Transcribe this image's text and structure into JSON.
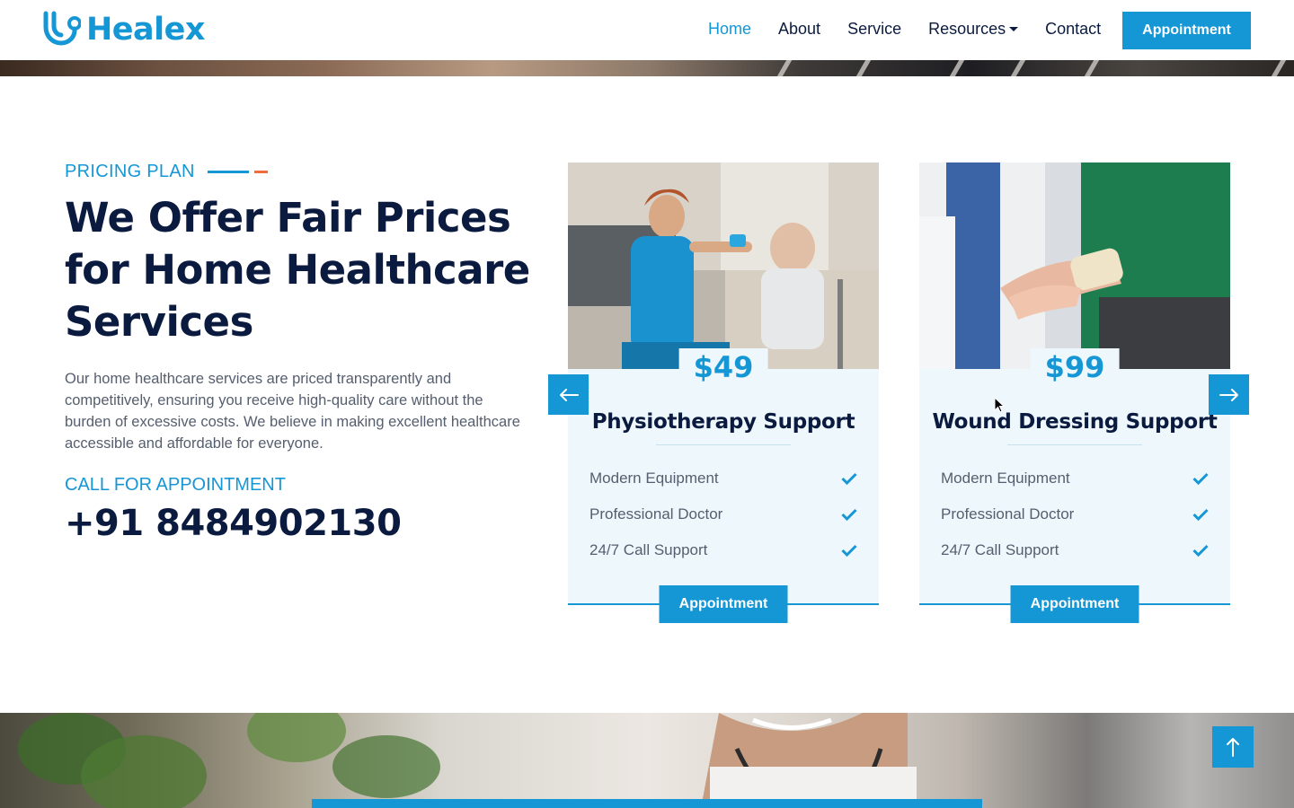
{
  "brand": {
    "name": "Healex",
    "accent": "#1596d5",
    "secondary_accent": "#f26b3a",
    "dark": "#0b1b3f"
  },
  "nav": {
    "items": [
      {
        "label": "Home",
        "active": true
      },
      {
        "label": "About",
        "active": false
      },
      {
        "label": "Service",
        "active": false
      },
      {
        "label": "Resources",
        "active": false,
        "has_dropdown": true
      },
      {
        "label": "Contact",
        "active": false
      }
    ],
    "cta_label": "Appointment"
  },
  "pricing": {
    "eyebrow": "PRICING PLAN",
    "heading": "We Offer Fair Prices for Home Healthcare Services",
    "description": "Our home healthcare services are priced transparently and competitively, ensuring you receive high-quality care without the burden of excessive costs. We believe in making excellent healthcare accessible and affordable for everyone.",
    "call_label": "CALL FOR APPOINTMENT",
    "phone": "+91 8484902130",
    "cards": [
      {
        "price": "$49",
        "title": "Physiotherapy Support",
        "features": [
          "Modern Equipment",
          "Professional Doctor",
          "24/7 Call Support"
        ],
        "button": "Appointment",
        "image_icon": "physiotherapy-photo"
      },
      {
        "price": "$99",
        "title": "Wound Dressing Support",
        "features": [
          "Modern Equipment",
          "Professional Doctor",
          "24/7 Call Support"
        ],
        "button": "Appointment",
        "image_icon": "wound-dressing-photo"
      }
    ]
  },
  "icons": {
    "prev": "arrow-left-icon",
    "next": "arrow-right-icon",
    "feature_check": "check-icon",
    "back_to_top": "arrow-up-icon"
  }
}
